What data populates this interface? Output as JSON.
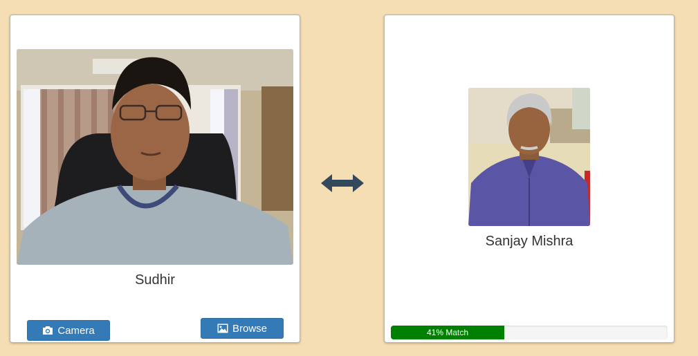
{
  "left_card": {
    "name": "Sudhir",
    "camera_label": "Camera",
    "browse_label": "Browse"
  },
  "right_card": {
    "name": "Sanjay Mishra",
    "match_label": "41% Match",
    "match_fraction": 0.41
  },
  "icons": {
    "compare": "double-arrow-icon",
    "camera": "camera-icon",
    "browse": "image-icon"
  },
  "colors": {
    "background": "#f5deb3",
    "button": "#337ab7",
    "match_bar": "#008000",
    "arrow": "#34495e"
  }
}
